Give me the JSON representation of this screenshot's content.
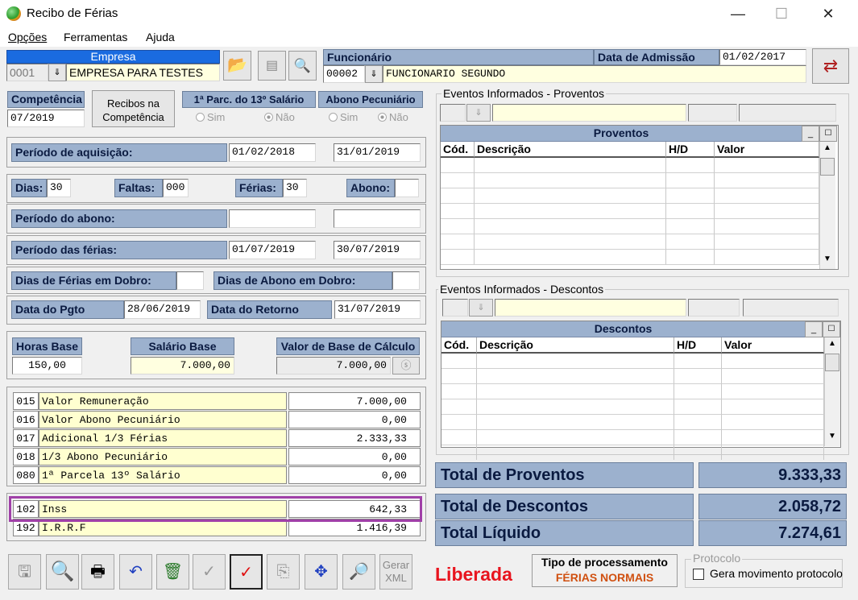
{
  "window": {
    "title": "Recibo de Férias",
    "minimize": "—",
    "maximize": "☐",
    "close": "✕"
  },
  "menu": [
    "Opções",
    "Ferramentas",
    "Ajuda"
  ],
  "empresa": {
    "header": "Empresa",
    "code": "0001",
    "name": "EMPRESA PARA TESTES"
  },
  "funcionario": {
    "header": "Funcionário",
    "code": "00002",
    "name": "FUNCIONARIO SEGUNDO",
    "admissao_label": "Data de Admissão",
    "admissao": "01/02/2017"
  },
  "competencia": {
    "label": "Competência",
    "value": "07/2019",
    "recibos_button": "Recibos na Competência"
  },
  "parc13": {
    "label": "1ª Parc. do 13º Salário",
    "sim": "Sim",
    "nao": "Não"
  },
  "abono_pec": {
    "label": "Abono Pecuniário",
    "sim": "Sim",
    "nao": "Não"
  },
  "aquisicao": {
    "label": "Período de aquisição:",
    "start": "01/02/2018",
    "end": "31/01/2019"
  },
  "dias": {
    "dias_label": "Dias:",
    "dias": "30",
    "faltas_label": "Faltas:",
    "faltas": "000",
    "ferias_label": "Férias:",
    "ferias": "30",
    "abono_label": "Abono:",
    "abono": ""
  },
  "periodo_abono": {
    "label": "Período do abono:",
    "start": "",
    "end": ""
  },
  "periodo_ferias": {
    "label": "Período das férias:",
    "start": "01/07/2019",
    "end": "30/07/2019"
  },
  "dobro": {
    "ferias_label": "Dias de Férias em Dobro:",
    "abono_label": "Dias de Abono em Dobro:"
  },
  "pgto": {
    "label": "Data do Pgto",
    "value": "28/06/2019",
    "retorno_label": "Data do Retorno",
    "retorno": "31/07/2019"
  },
  "base": {
    "horas_label": "Horas Base",
    "horas": "150,00",
    "salario_label": "Salário Base",
    "salario": "7.000,00",
    "calc_label": "Valor de Base de Cálculo",
    "calc": "7.000,00"
  },
  "rubricas": [
    {
      "code": "015",
      "desc": "Valor Remuneração",
      "value": "7.000,00"
    },
    {
      "code": "016",
      "desc": "Valor Abono Pecuniário",
      "value": "0,00"
    },
    {
      "code": "017",
      "desc": "Adicional 1/3 Férias",
      "value": "2.333,33"
    },
    {
      "code": "018",
      "desc": "1/3 Abono Pecuniário",
      "value": "0,00"
    },
    {
      "code": "080",
      "desc": "1ª Parcela 13º Salário",
      "value": "0,00"
    }
  ],
  "descontos_lista": [
    {
      "code": "102",
      "desc": "Inss",
      "value": "642,33"
    },
    {
      "code": "192",
      "desc": "I.R.R.F",
      "value": "1.416,39"
    }
  ],
  "eventos_proventos": {
    "legend": "Eventos Informados - Proventos",
    "grid_title": "Proventos",
    "cols": [
      "Cód.",
      "Descrição",
      "H/D",
      "Valor"
    ]
  },
  "eventos_descontos": {
    "legend": "Eventos Informados - Descontos",
    "grid_title": "Descontos",
    "cols": [
      "Cód.",
      "Descrição",
      "H/D",
      "Valor"
    ]
  },
  "totais": {
    "proventos_label": "Total de Proventos",
    "proventos": "9.333,33",
    "descontos_label": "Total de Descontos",
    "descontos": "2.058,72",
    "liquido_label": "Total Líquido",
    "liquido": "7.274,61"
  },
  "status": "Liberada",
  "status_color": "#e8141e",
  "tipo": {
    "label": "Tipo de processamento",
    "value": "FÉRIAS NORMAIS"
  },
  "protocolo": {
    "legend": "Protocolo",
    "checkbox": "Gera movimento protocolo"
  },
  "toolbar": {
    "gerar_xml": "Gerar XML"
  },
  "highlight_color": "#a040a8"
}
